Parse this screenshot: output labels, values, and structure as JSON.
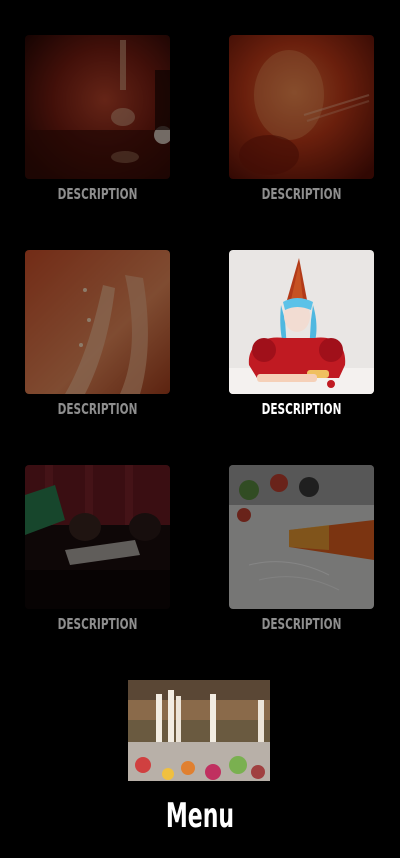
{
  "gallery": {
    "items": [
      {
        "caption": "DESCRIPTION",
        "image": "candle-table-photo"
      },
      {
        "caption": "DESCRIPTION",
        "image": "red-blur-photo"
      },
      {
        "caption": "DESCRIPTION",
        "image": "hands-reaching-photo"
      },
      {
        "caption": "DESCRIPTION",
        "image": "party-hat-clown-photo"
      },
      {
        "caption": "DESCRIPTION",
        "image": "lying-people-photo"
      },
      {
        "caption": "DESCRIPTION",
        "image": "fallen-glass-photo"
      }
    ]
  },
  "menu": {
    "label": "Menu",
    "image": "dinner-table-candles-photo"
  },
  "colors": {
    "background": "#000000",
    "caption": "#8e8e8e",
    "caption_active": "#ffffff"
  }
}
